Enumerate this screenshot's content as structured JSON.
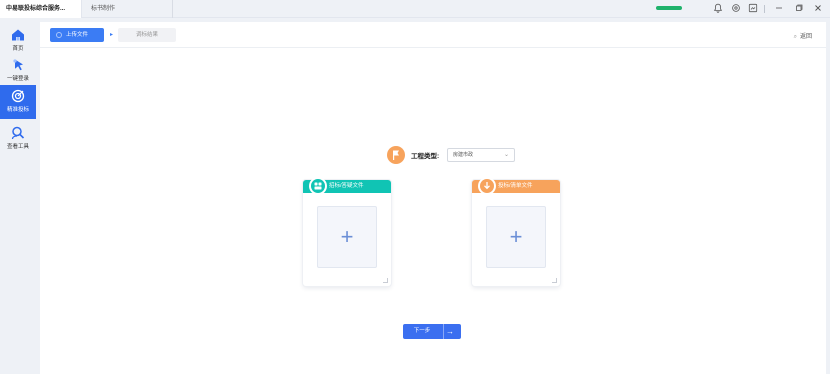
{
  "titlebar": {
    "tabs": [
      {
        "label": "中易联投标综合服务..."
      },
      {
        "label": "标书制作"
      }
    ],
    "progress": 1.0,
    "icons": [
      "bell-icon",
      "settings-icon",
      "screenshot-icon",
      "minimize-icon",
      "restore-icon",
      "close-icon"
    ]
  },
  "sidebar": {
    "items": [
      {
        "label": "首页",
        "icon": "home-icon"
      },
      {
        "label": "一键登录",
        "icon": "cursor-icon"
      },
      {
        "label": "精准投标",
        "icon": "target-icon",
        "active": true
      },
      {
        "label": "查看工具",
        "icon": "search-user-icon"
      }
    ]
  },
  "steps": {
    "step1": "上传文件",
    "step2": "调标结果",
    "back": "返回"
  },
  "project_type": {
    "label": "工程类型:",
    "value": "房建市政"
  },
  "cards": [
    {
      "title": "招标/答疑文件",
      "color": "#10c4b4",
      "icon": "document-icon"
    },
    {
      "title": "投标/清单文件",
      "color": "#f7a35c",
      "icon": "download-icon"
    }
  ],
  "next_button": {
    "label": "下一步"
  },
  "colors": {
    "accent": "#3b6ff0",
    "teal": "#10c4b4",
    "orange": "#f7a35c"
  }
}
